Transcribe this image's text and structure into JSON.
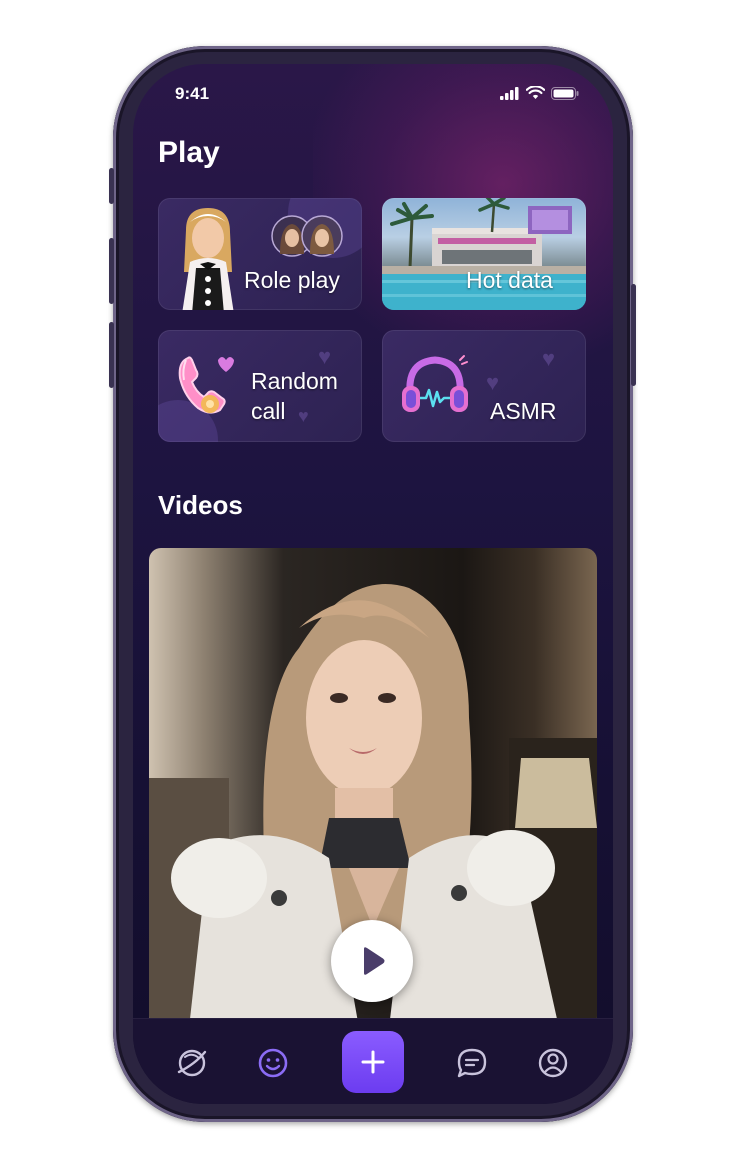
{
  "status_bar": {
    "time": "9:41"
  },
  "sections": {
    "play": "Play",
    "videos": "Videos"
  },
  "play_cards": [
    {
      "label": "Role play",
      "icon": "maid-avatar-icon"
    },
    {
      "label": "Hot data",
      "icon": "resort-photo-icon"
    },
    {
      "label_line1": "Random",
      "label_line2": "call",
      "icon": "phone-call-icon"
    },
    {
      "label": "ASMR",
      "icon": "headphones-icon"
    }
  ],
  "video": {
    "play_icon": "play-icon"
  },
  "tab_bar": {
    "items": [
      "explore-icon",
      "smile-icon",
      "add-icon",
      "chat-icon",
      "profile-icon"
    ],
    "active": "smile-icon"
  },
  "colors": {
    "accent": "#7b4cff",
    "active_tab": "#8b6cf5",
    "inactive_tab": "#c9c3dc",
    "background": "#161034"
  }
}
